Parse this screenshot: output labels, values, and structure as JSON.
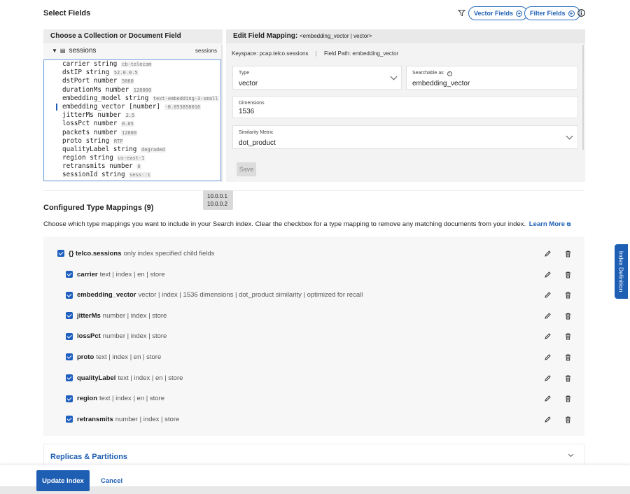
{
  "header": {
    "title": "Select Fields",
    "vector_fields": "Vector Fields",
    "filter_fields": "Filter Fields"
  },
  "left_panel": {
    "title": "Choose a Collection or Document Field",
    "collection": "sessions",
    "collection_right": "sessions",
    "fields": [
      {
        "name": "carrier",
        "type": "string",
        "sample": "cb-telecom"
      },
      {
        "name": "dstIP",
        "type": "string",
        "sample": "52.0.0.5"
      },
      {
        "name": "dstPort",
        "type": "number",
        "sample": "5060"
      },
      {
        "name": "durationMs",
        "type": "number",
        "sample": "120000"
      },
      {
        "name": "embedding_model",
        "type": "string",
        "sample": "text-embedding-3-small"
      },
      {
        "name": "embedding_vector",
        "type": "[number]",
        "sample": "-0.053858016"
      },
      {
        "name": "jitterMs",
        "type": "number",
        "sample": "2.5"
      },
      {
        "name": "lossPct",
        "type": "number",
        "sample": "0.05"
      },
      {
        "name": "packets",
        "type": "number",
        "sample": "12000"
      },
      {
        "name": "proto",
        "type": "string",
        "sample": "RTP"
      },
      {
        "name": "qualityLabel",
        "type": "string",
        "sample": "degraded"
      },
      {
        "name": "region",
        "type": "string",
        "sample": "us-east-1"
      },
      {
        "name": "retransmits",
        "type": "number",
        "sample": "0"
      },
      {
        "name": "sessionId",
        "type": "string",
        "sample": "sess::1"
      }
    ]
  },
  "right_panel": {
    "title": "Edit Field Mapping:",
    "title_sub": "<embedding_vector | vector>",
    "keyspace": "Keyspace: pcap.telco.sessions",
    "separator": "|",
    "field_path": "Field Path: embedding_vector",
    "type_label": "Type",
    "type_value": "vector",
    "searchable_label": "Searchable as",
    "searchable_value": "embedding_vector",
    "dimensions_label": "Dimensions",
    "dimensions_value": "1536",
    "similarity_label": "Similarity Metric",
    "similarity_value": "dot_product",
    "save": "Save"
  },
  "tooltip": {
    "line1": "10.0.0.1",
    "line2": "10.0.0.2"
  },
  "mappings": {
    "title": "Configured Type Mappings (9)",
    "description": "Choose which type mappings you want to include in your Search index. Clear the checkbox for a type mapping to remove any matching documents from your index.",
    "learn_more": "Learn More",
    "root": {
      "name": "{} telco.sessions",
      "desc": "only index specified child fields"
    },
    "items": [
      {
        "name": "carrier",
        "desc": "text | index | en | store"
      },
      {
        "name": "embedding_vector",
        "desc": "vector | index | 1536 dimensions | dot_product similarity | optimized for recall"
      },
      {
        "name": "jitterMs",
        "desc": "number | index | store"
      },
      {
        "name": "lossPct",
        "desc": "number | index | store"
      },
      {
        "name": "proto",
        "desc": "text | index | en | store"
      },
      {
        "name": "qualityLabel",
        "desc": "text | index | en | store"
      },
      {
        "name": "region",
        "desc": "text | index | en | store"
      },
      {
        "name": "retransmits",
        "desc": "number | index | store"
      }
    ]
  },
  "replicas": {
    "title": "Replicas & Partitions"
  },
  "footer": {
    "update": "Update Index",
    "cancel": "Cancel"
  },
  "side_tab": "Index Definition",
  "colors": {
    "accent": "#1e5fb4",
    "panel": "#f3f3f3"
  }
}
